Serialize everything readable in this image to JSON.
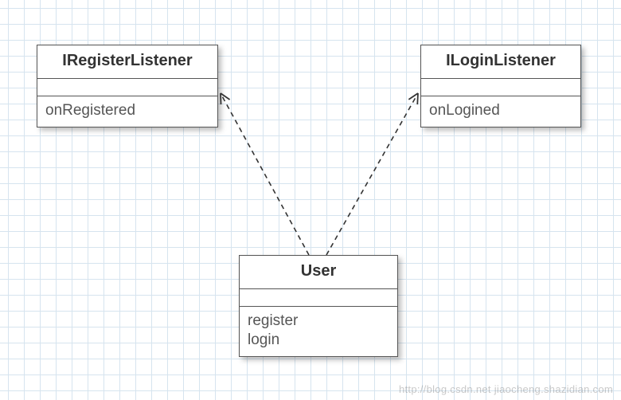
{
  "classes": {
    "register_listener": {
      "name": "IRegisterListener",
      "methods": [
        "onRegistered"
      ]
    },
    "login_listener": {
      "name": "ILoginListener",
      "methods": [
        "onLogined"
      ]
    },
    "user": {
      "name": "User",
      "methods": [
        "register",
        "login"
      ]
    }
  },
  "relationships": [
    {
      "from": "User",
      "to": "IRegisterListener",
      "type": "dependency"
    },
    {
      "from": "User",
      "to": "ILoginListener",
      "type": "dependency"
    }
  ],
  "watermark": "http://blog.csdn.net jiaocheng.shazidian.com"
}
